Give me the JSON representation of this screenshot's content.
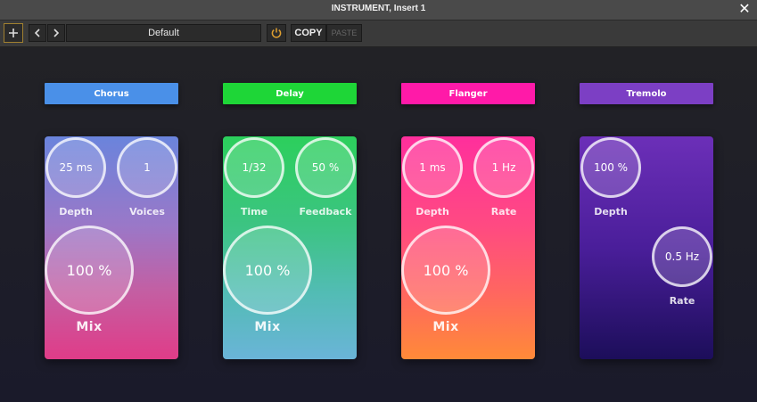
{
  "window": {
    "title": "INSTRUMENT, Insert 1"
  },
  "toolbar": {
    "preset": "Default",
    "copy_label": "COPY",
    "paste_label": "PASTE"
  },
  "modules": [
    {
      "name": "Chorus",
      "color": "#4a90e8",
      "knobs": [
        {
          "value": "25 ms",
          "label": "Depth"
        },
        {
          "value": "1",
          "label": "Voices"
        }
      ],
      "mix": {
        "value": "100 %",
        "label": "Mix"
      }
    },
    {
      "name": "Delay",
      "color": "#1ed637",
      "knobs": [
        {
          "value": "1/32",
          "label": "Time"
        },
        {
          "value": "50 %",
          "label": "Feedback"
        }
      ],
      "mix": {
        "value": "100 %",
        "label": "Mix"
      }
    },
    {
      "name": "Flanger",
      "color": "#ff1aa8",
      "knobs": [
        {
          "value": "1 ms",
          "label": "Depth"
        },
        {
          "value": "1 Hz",
          "label": "Rate"
        }
      ],
      "mix": {
        "value": "100 %",
        "label": "Mix"
      }
    },
    {
      "name": "Tremolo",
      "color": "#7c3fc4",
      "knobs": [
        {
          "value": "100 %",
          "label": "Depth"
        },
        {
          "value": "0.5 Hz",
          "label": "Rate"
        }
      ]
    }
  ]
}
